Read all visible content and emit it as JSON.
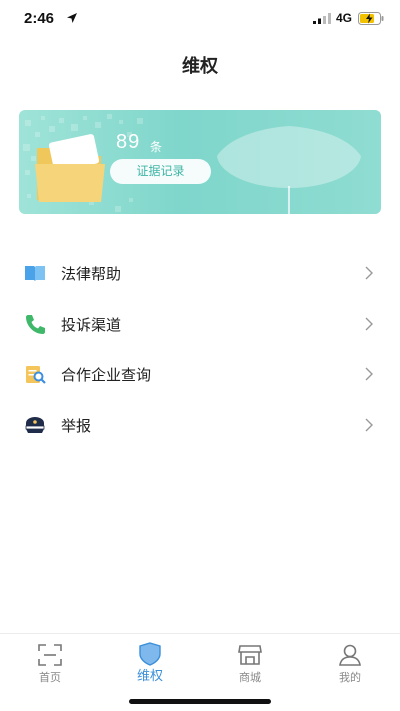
{
  "status_bar": {
    "time": "2:46",
    "network": "4G",
    "icons": [
      "location-arrow-icon",
      "signal-icon",
      "battery-charging-icon"
    ]
  },
  "header": {
    "title": "维权"
  },
  "banner": {
    "count": "89",
    "count_unit": "条",
    "records_button_label": "证据记录",
    "colors": {
      "gradient_start": "#9fe3d8",
      "gradient_end": "#8fdcd2",
      "button_text": "#3fb5a6"
    }
  },
  "menu": {
    "items": [
      {
        "label": "法律帮助",
        "icon": "book-icon"
      },
      {
        "label": "投诉渠道",
        "icon": "phone-icon"
      },
      {
        "label": "合作企业查询",
        "icon": "document-search-icon"
      },
      {
        "label": "举报",
        "icon": "police-cap-icon"
      }
    ]
  },
  "tab_bar": {
    "tabs": [
      {
        "label": "首页",
        "icon": "scan-frame-icon",
        "active": false
      },
      {
        "label": "维权",
        "icon": "shield-icon",
        "active": true
      },
      {
        "label": "商城",
        "icon": "store-icon",
        "active": false
      },
      {
        "label": "我的",
        "icon": "user-icon",
        "active": false
      }
    ],
    "active_color": "#3b8fd9",
    "inactive_color": "#888888"
  }
}
